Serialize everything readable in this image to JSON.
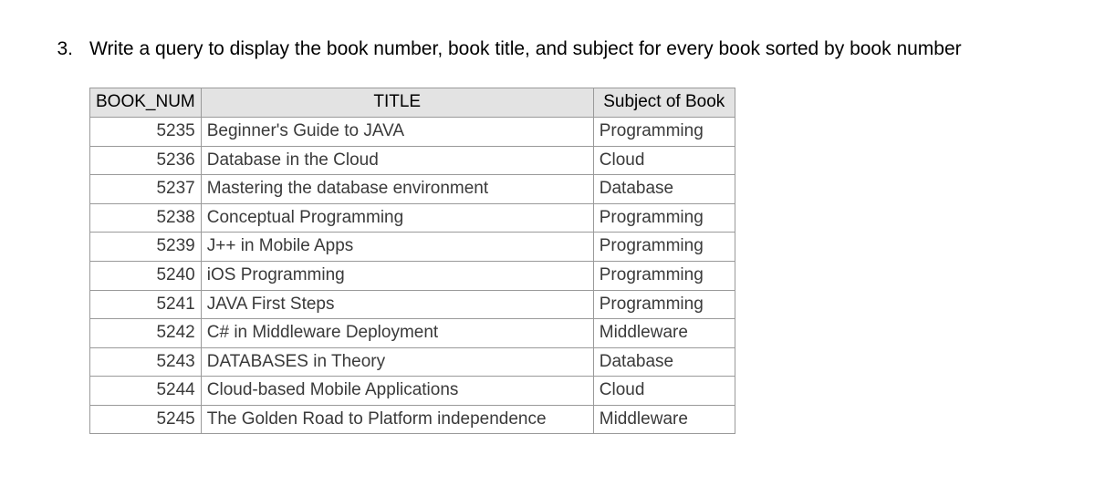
{
  "question": {
    "number": "3.",
    "text": "Write a query to display the book number, book title, and subject for every book sorted by book number"
  },
  "chart_data": {
    "type": "table",
    "columns": [
      "BOOK_NUM",
      "TITLE",
      "Subject of Book"
    ],
    "rows": [
      {
        "book_num": "5235",
        "title": "Beginner's Guide to JAVA",
        "subject": "Programming"
      },
      {
        "book_num": "5236",
        "title": "Database in the Cloud",
        "subject": "Cloud"
      },
      {
        "book_num": "5237",
        "title": "Mastering the database environment",
        "subject": "Database"
      },
      {
        "book_num": "5238",
        "title": "Conceptual Programming",
        "subject": "Programming"
      },
      {
        "book_num": "5239",
        "title": "J++ in Mobile Apps",
        "subject": "Programming"
      },
      {
        "book_num": "5240",
        "title": "iOS Programming",
        "subject": "Programming"
      },
      {
        "book_num": "5241",
        "title": "JAVA First Steps",
        "subject": "Programming"
      },
      {
        "book_num": "5242",
        "title": "C# in Middleware Deployment",
        "subject": "Middleware"
      },
      {
        "book_num": "5243",
        "title": "DATABASES in Theory",
        "subject": "Database"
      },
      {
        "book_num": "5244",
        "title": "Cloud-based Mobile Applications",
        "subject": "Cloud"
      },
      {
        "book_num": "5245",
        "title": "The Golden Road to Platform independence",
        "subject": "Middleware"
      }
    ]
  }
}
